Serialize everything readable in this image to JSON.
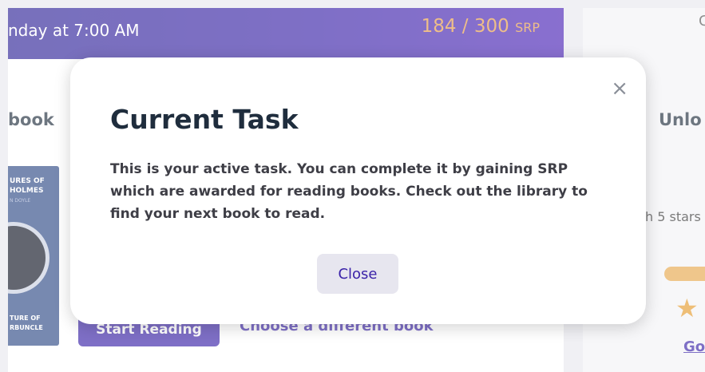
{
  "banner": {
    "schedule_text": "nday at 7:00 AM",
    "srp_value": "184 / 300",
    "srp_unit": "SRP"
  },
  "current_book": {
    "section_title": "book",
    "cover": {
      "title_line1": "URES OF",
      "title_line2": "HOLMES",
      "author": "N DOYLE",
      "bottom_line1": "TURE OF",
      "bottom_line2": "RBUNCLE"
    },
    "start_button": "Start Reading",
    "choose_link": "Choose a different book"
  },
  "side_panel": {
    "top_letter": "C",
    "title": "Unlo",
    "subtitle": "h 5 stars",
    "progress_fraction": 0.5,
    "link": "Go"
  },
  "modal": {
    "title": "Current Task",
    "body": "This is your active task. You can complete it by gaining SRP which are awarded for reading books. Check out the library to find your next book to read.",
    "close_icon": "×",
    "close_button": "Close"
  },
  "colors": {
    "brand_purple": "#3a22a8",
    "srp_orange": "#e59b4a",
    "title_dark": "#1f2d3d"
  }
}
